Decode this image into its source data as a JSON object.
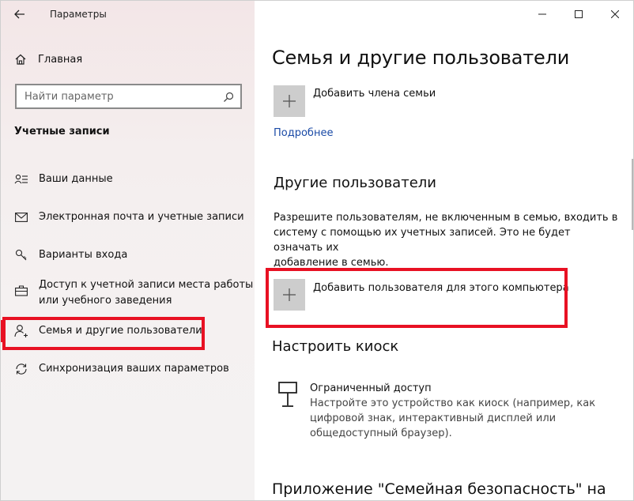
{
  "window": {
    "title": "Параметры",
    "back_label": "←",
    "controls": {
      "minimize": "minimize",
      "maximize": "maximize",
      "close": "close"
    }
  },
  "sidebar": {
    "home_label": "Главная",
    "search_placeholder": "Найти параметр",
    "section_title": "Учетные записи",
    "items": [
      {
        "label": "Ваши данные",
        "icon": "user-list-icon"
      },
      {
        "label": "Электронная почта и учетные записи",
        "icon": "mail-icon"
      },
      {
        "label": "Варианты входа",
        "icon": "key-icon"
      },
      {
        "label": "Доступ к учетной записи места работы",
        "label2": "или учебного заведения",
        "icon": "briefcase-icon"
      },
      {
        "label": "Семья и другие пользователи",
        "icon": "person-add-icon",
        "selected": true
      },
      {
        "label": "Синхронизация ваших параметров",
        "icon": "sync-icon"
      }
    ]
  },
  "main": {
    "title": "Семья и другие пользователи",
    "add_family_label": "Добавить члена семьи",
    "more_link": "Подробнее",
    "other_users_title": "Другие пользователи",
    "other_users_desc": [
      "Разрешите пользователям, не включенным в семью, входить в",
      "систему с помощью их учетных записей. Это не будет означать их",
      "добавление в семью."
    ],
    "add_user_label": "Добавить пользователя для этого компьютера",
    "kiosk_title": "Настроить киоск",
    "kiosk_item_title": "Ограниченный доступ",
    "kiosk_item_desc": [
      "Настройте это устройство как киоск (например, как",
      "цифровой знак, интерактивный дисплей или",
      "общедоступный браузер)."
    ],
    "bottom_title": "Приложение \"Семейная безопасность\" на"
  },
  "colors": {
    "accent": "#e81123",
    "link": "#1a4aa6",
    "tile": "#cdcdcd"
  }
}
